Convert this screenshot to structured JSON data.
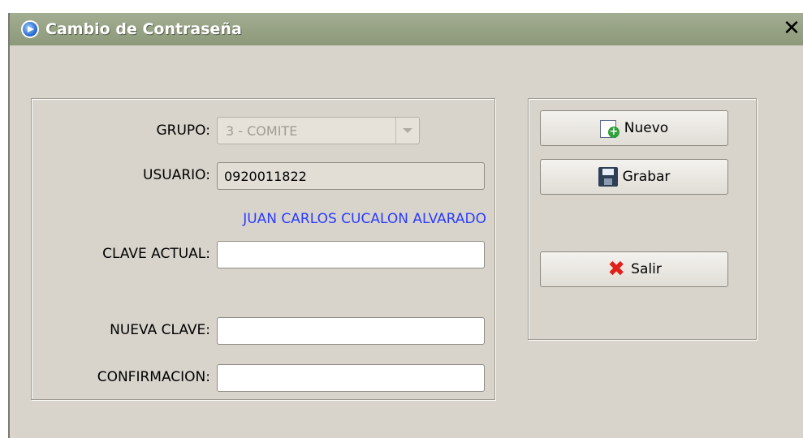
{
  "window": {
    "title": "Cambio de Contraseña",
    "close_symbol": "✕"
  },
  "form": {
    "grupo_label": "GRUPO:",
    "grupo_value": "3 - COMITE",
    "usuario_label": "USUARIO:",
    "usuario_value": "0920011822",
    "user_full_name": "JUAN CARLOS CUCALON ALVARADO",
    "clave_actual_label": "CLAVE ACTUAL:",
    "clave_actual_value": "",
    "nueva_clave_label": "NUEVA CLAVE:",
    "nueva_clave_value": "",
    "confirmacion_label": "CONFIRMACION:",
    "confirmacion_value": ""
  },
  "actions": {
    "nuevo_label": "Nuevo",
    "grabar_label": "Grabar",
    "salir_label": "Salir"
  },
  "icons": {
    "title": "app-circle-icon",
    "close": "close-icon",
    "dropdown": "chevron-down-icon",
    "nuevo": "new-document-icon",
    "grabar": "floppy-save-icon",
    "salir": "red-x-icon"
  },
  "colors": {
    "titlebar": "#95a083",
    "dialog_bg": "#d8d4cc",
    "user_name": "#2a3cff",
    "exit_icon": "#e0201a"
  }
}
